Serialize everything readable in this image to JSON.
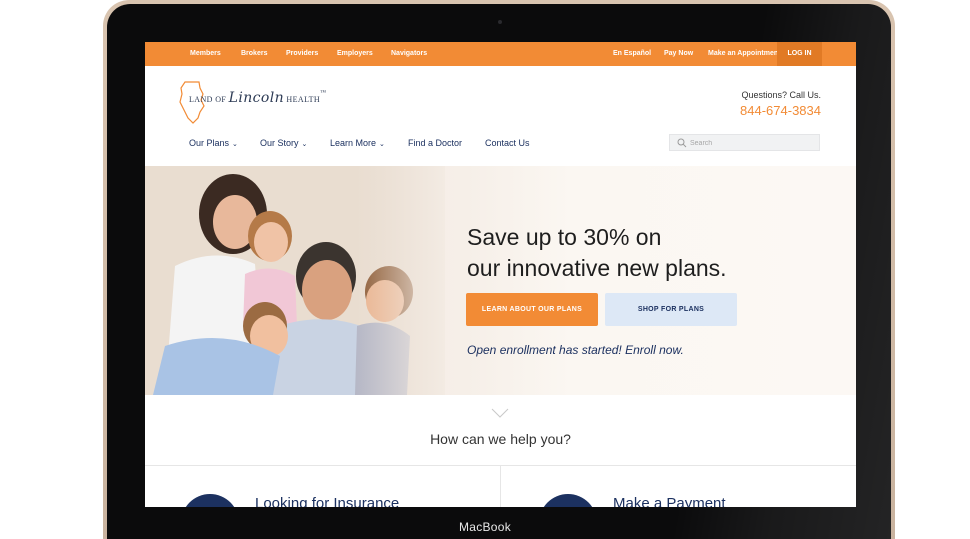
{
  "device": {
    "label": "MacBook"
  },
  "topbar": {
    "left_links": [
      "Members",
      "Brokers",
      "Providers",
      "Employers",
      "Navigators"
    ],
    "right_links": [
      "En Español",
      "Pay Now",
      "Make an Appointment"
    ],
    "login_label": "LOG IN",
    "color": "#f28b35"
  },
  "header": {
    "logo_text_left": "LAND OF",
    "logo_text_script": "Lincoln",
    "logo_text_right": "HEALTH",
    "logo_trademark": "™",
    "call_label": "Questions? Call Us.",
    "phone": "844-674-3834"
  },
  "nav": {
    "items": [
      {
        "label": "Our Plans",
        "has_dropdown": true
      },
      {
        "label": "Our Story",
        "has_dropdown": true
      },
      {
        "label": "Learn More",
        "has_dropdown": true
      },
      {
        "label": "Find a Doctor",
        "has_dropdown": false
      },
      {
        "label": "Contact Us",
        "has_dropdown": false
      }
    ],
    "dropdown_icon": "chevron-down-icon",
    "search_placeholder": "Search"
  },
  "hero": {
    "title_line1": "Save up to 30% on",
    "title_line2": "our innovative new plans.",
    "primary_button": "LEARN ABOUT OUR PLANS",
    "secondary_button": "SHOP FOR PLANS",
    "enroll_text": "Open enrollment has started! Enroll now."
  },
  "help": {
    "title": "How can we help you?",
    "cards": [
      {
        "title": "Looking for Insurance"
      },
      {
        "title": "Make a Payment"
      }
    ]
  },
  "colors": {
    "accent": "#f28b35",
    "navy": "#1c3160",
    "light_blue": "#dde8f6"
  }
}
